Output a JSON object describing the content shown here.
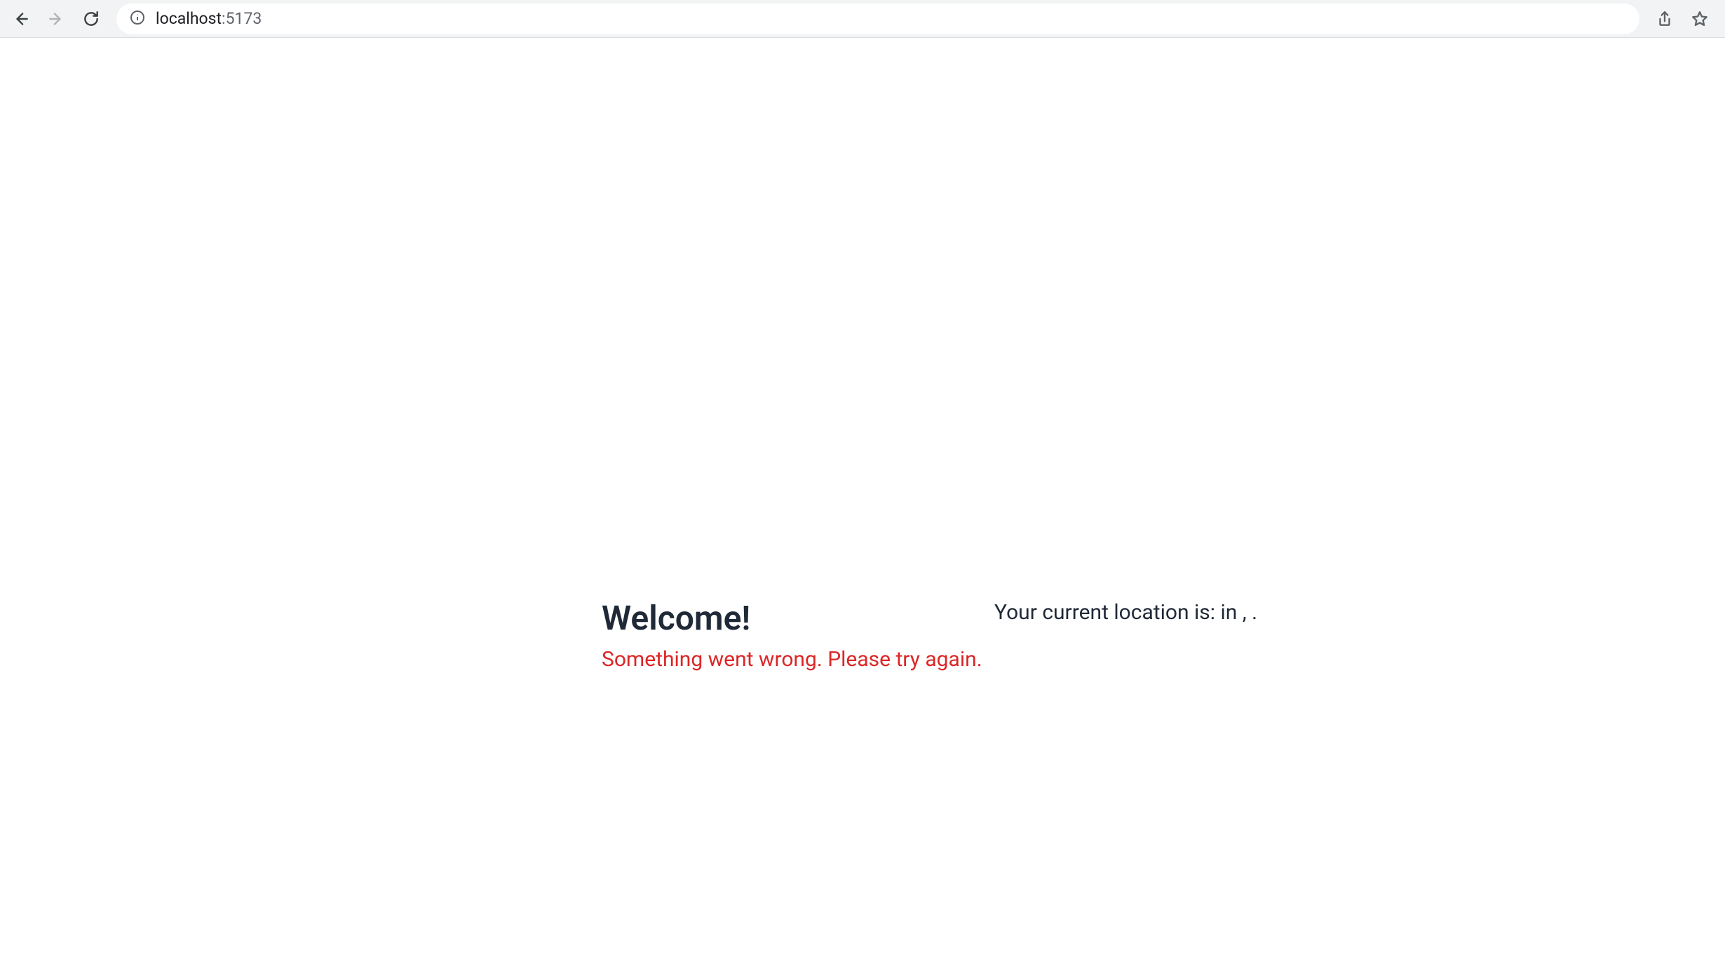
{
  "browser": {
    "url_host": "localhost",
    "url_port": ":5173"
  },
  "page": {
    "heading": "Welcome!",
    "error": "Something went wrong. Please try again.",
    "location_text": "Your current location is: in , ."
  }
}
